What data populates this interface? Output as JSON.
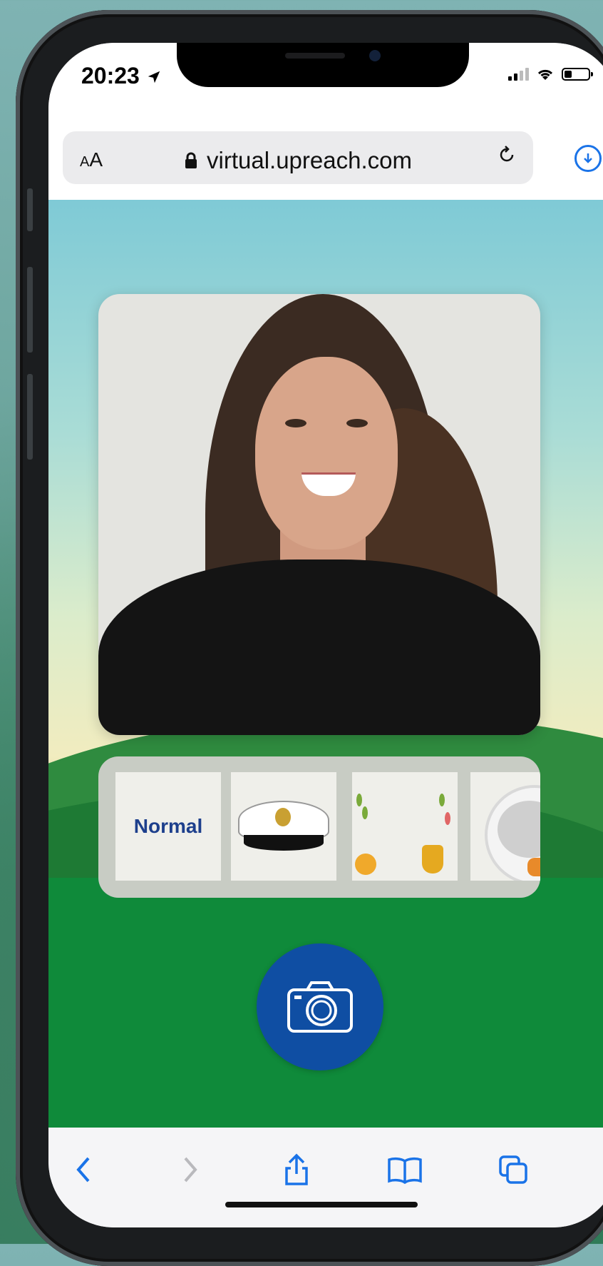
{
  "status_bar": {
    "time": "20:23",
    "location_icon": "location-arrow-icon",
    "signal_icon": "cellular-signal-icon",
    "wifi_icon": "wifi-icon",
    "battery_icon": "battery-icon"
  },
  "browser": {
    "text_size_label_small": "A",
    "text_size_label_large": "A",
    "url": "virtual.upreach.com",
    "lock_icon": "lock-icon",
    "reload_icon": "reload-icon",
    "download_icon": "download-icon",
    "accent_color": "#1a73e8"
  },
  "page": {
    "filters": [
      {
        "label": "Normal",
        "icon": null
      },
      {
        "label": "",
        "icon": "captain-hat-icon"
      },
      {
        "label": "",
        "icon": "awards-icon"
      },
      {
        "label": "",
        "icon": "astronaut-helmet-icon"
      }
    ],
    "capture_button_icon": "camera-icon",
    "capture_button_color": "#0f4ea3",
    "filter_label_color": "#1d3f8c"
  },
  "toolbar": {
    "back_icon": "chevron-left-icon",
    "forward_icon": "chevron-right-icon",
    "share_icon": "share-icon",
    "bookmarks_icon": "book-icon",
    "tabs_icon": "tabs-icon"
  }
}
